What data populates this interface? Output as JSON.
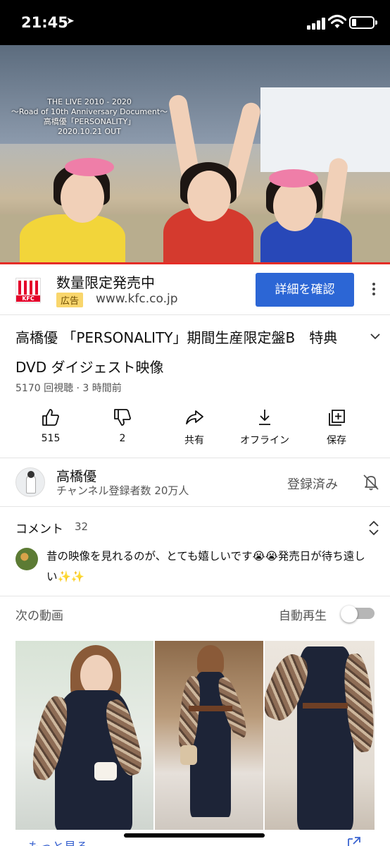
{
  "status_bar": {
    "time": "21:45",
    "location_icon": "location-arrow-icon",
    "signal_icon": "cellular-signal-icon",
    "wifi_icon": "wifi-icon",
    "battery_icon": "battery-low-icon"
  },
  "video": {
    "overlay_lines": [
      "THE LIVE 2010 - 2020",
      "〜Road of 10th Anniversary Document〜",
      "高橋優「PERSONALITY」",
      "2020.10.21 OUT"
    ],
    "progress_color": "#e52d27"
  },
  "ad": {
    "logo_text": "KFC",
    "title": "数量限定発売中",
    "badge": "広告",
    "url": "www.kfc.co.jp",
    "cta": "詳細を確認",
    "cta_color": "#2c66d5"
  },
  "video_info": {
    "title": "高橋優 「PERSONALITY」期間生産限定盤B　特典DVD ダイジェスト映像",
    "meta": "5170 回視聴 · 3 時間前"
  },
  "actions": [
    {
      "icon": "thumbs-up-icon",
      "label": "515"
    },
    {
      "icon": "thumbs-down-icon",
      "label": "2"
    },
    {
      "icon": "share-icon",
      "label": "共有"
    },
    {
      "icon": "download-icon",
      "label": "オフライン"
    },
    {
      "icon": "add-to-playlist-icon",
      "label": "保存"
    }
  ],
  "channel": {
    "name": "高橋優",
    "subscribers": "チャンネル登録者数 20万人",
    "subscribed_label": "登録済み",
    "bell_icon": "bell-off-icon"
  },
  "comments": {
    "heading": "コメント",
    "count": "32",
    "top_comment": "昔の映像を見れるのが、とても嬉しいです😭😭発売日が待ち遠しい✨✨"
  },
  "next_video": {
    "label": "次の動画",
    "autoplay_label": "自動再生"
  },
  "bottom": {
    "more_link": "もっと見る",
    "external_icon": "open-external-icon"
  }
}
